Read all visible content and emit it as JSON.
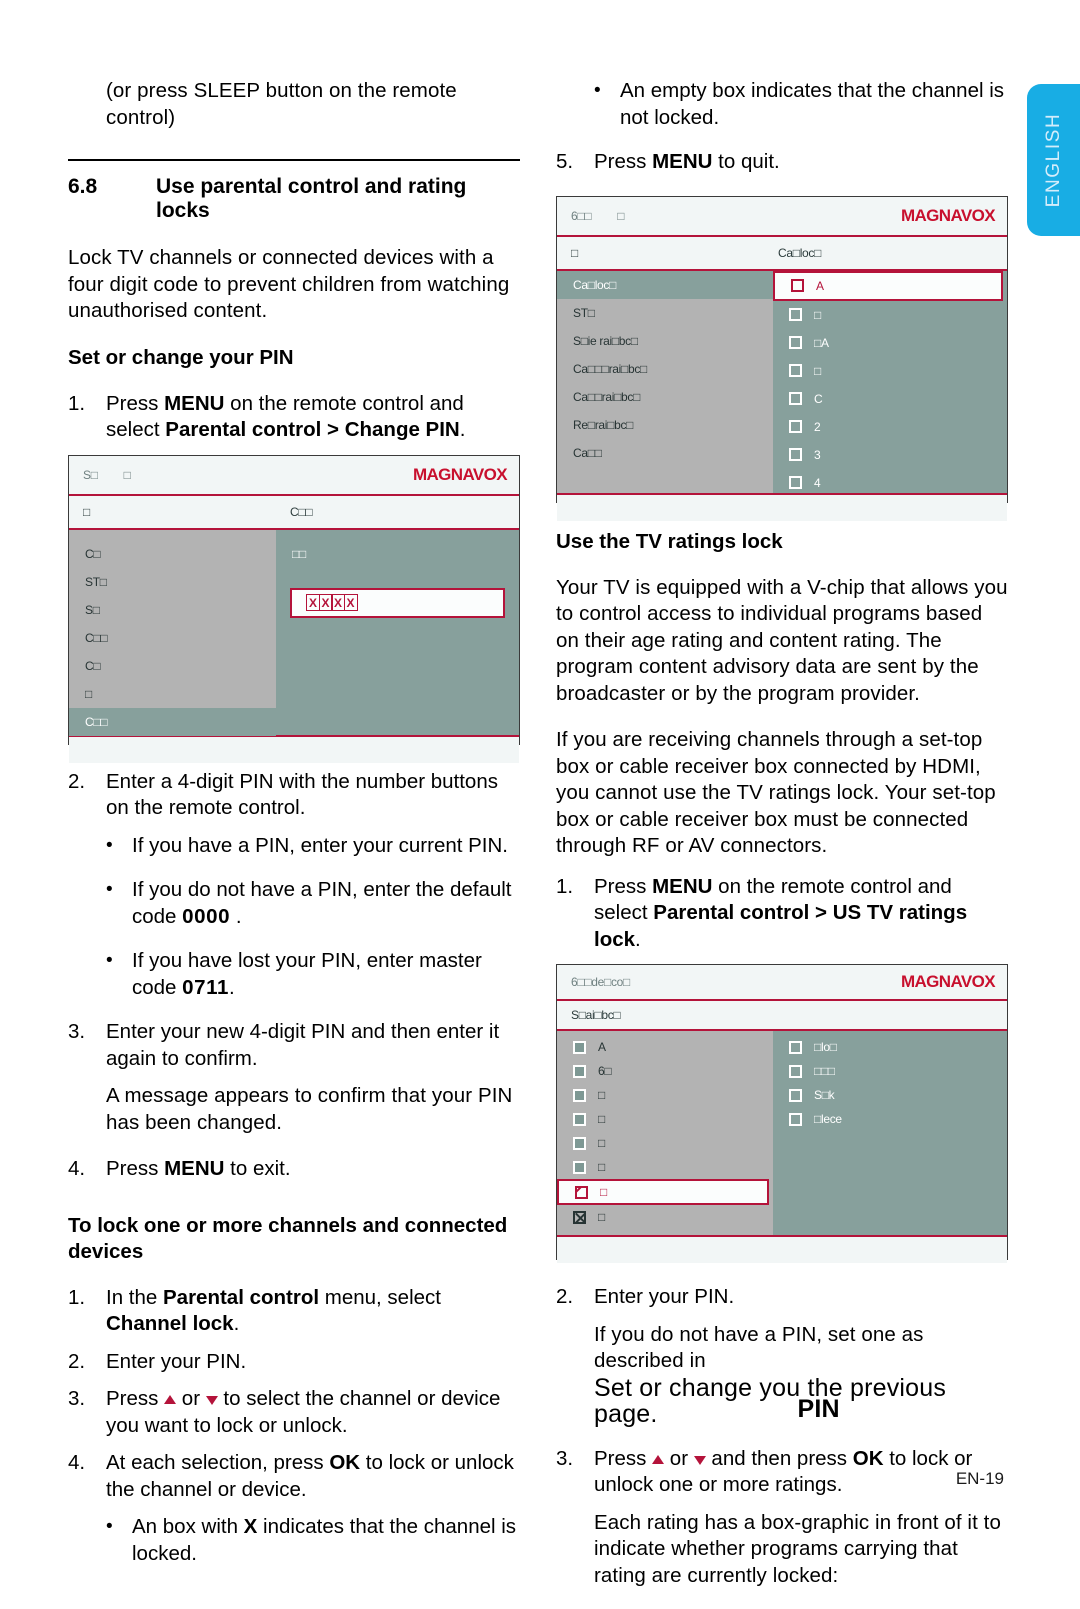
{
  "page": {
    "number_label": "EN-19",
    "language_tab": "ENGLISH",
    "accent_red": "#b4133a",
    "logo_red": "#c8102e",
    "tab_blue": "#18ade4",
    "pane_gray": "#b3b3b3",
    "pane_teal": "#87a09c"
  },
  "left_column": {
    "lead_line": "(or press SLEEP button on the remote control)",
    "section": {
      "number": "6.8",
      "title": "Use parental control and rating locks"
    },
    "intro": "Lock TV channels or connected devices with a four digit code to prevent children from watching unauthorised content.",
    "heading_pin": "Set or change your PIN",
    "step1": {
      "num": "1.",
      "text_a": "Press ",
      "bold_menu": "MENU",
      "text_b": " on the remote control and select",
      "bold_path": "Parental control > Change PIN",
      "text_c": "."
    },
    "step2": {
      "num": "2.",
      "text": "Enter a 4-digit PIN with the number buttons on the remote control."
    },
    "bullets_pin": [
      {
        "text": "If you have a PIN, enter your current PIN."
      },
      {
        "text_a": "If you do not have a PIN, enter the default code ",
        "code": "0000",
        "text_b": " ."
      },
      {
        "text_a": "If you have lost your PIN, enter master code ",
        "code": "0711",
        "text_b": "."
      }
    ],
    "step3": {
      "num": "3.",
      "text": "Enter your new 4-digit PIN and then enter it again to confirm.",
      "note": "A message appears to confirm that your PIN has been changed."
    },
    "step4": {
      "num": "4.",
      "text_a": "Press ",
      "bold_menu": "MENU",
      "text_b": " to exit."
    },
    "heading_lock": "To lock one or more channels and connected devices",
    "lock_step1": {
      "num": "1.",
      "text_a": "In the ",
      "bold_a": "Parental control",
      "text_b": " menu, select ",
      "bold_b": "Channel lock",
      "text_c": "."
    },
    "lock_step2": {
      "num": "2.",
      "text": "Enter your PIN."
    },
    "lock_step3": {
      "num": "3.",
      "text_a": "Press ",
      "text_b": " or ",
      "text_c": " to select the channel or device you want to lock or unlock."
    },
    "lock_step4": {
      "num": "4.",
      "text_a": "At each selection, press ",
      "bold_ok": "OK",
      "text_b": " to lock or unlock the channel or device."
    },
    "lock_bullet": {
      "text_a": "An box with ",
      "bold_x": "X",
      "text_b": " indicates that the channel is locked."
    }
  },
  "right_column": {
    "bullet_empty_box": "An empty box indicates that the channel is not locked.",
    "step5": {
      "num": "5.",
      "text_a": "Press ",
      "bold_menu": "MENU",
      "text_b": " to quit."
    },
    "heading_tv_ratings": "Use the TV ratings lock",
    "para_vchip": "Your TV is equipped with a V-chip that allows you to control access to individual programs based on their age rating and content rating. The program content advisory data are sent by the broadcaster or by the program provider.",
    "para_settop": "If you are receiving channels through a set-top box or cable receiver box connected by HDMI, you cannot use the TV ratings lock. Your set-top box or cable receiver box must be connected through RF or AV connectors.",
    "rate_step1": {
      "num": "1.",
      "text_a": "Press ",
      "bold_menu": "MENU",
      "text_b": " on the remote control and select",
      "bold_path": "Parental control > US TV ratings lock",
      "text_c": "."
    },
    "rate_step2": {
      "num": "2.",
      "text": "Enter your PIN.",
      "note_a": "If you do not have a PIN, set one as described in",
      "note_overlap_under": "Set or change you ",
      "note_overlap_over": "PIN",
      "note_overlap_tail": "the previous page."
    },
    "rate_step3": {
      "num": "3.",
      "text_a": "Press ",
      "text_b": " or ",
      "text_c": " and then press ",
      "bold_ok": "OK",
      "text_d": " to lock or unlock one or more ratings.",
      "note": "Each rating has a box-graphic in front of it to indicate whether programs carrying that rating are currently locked:"
    }
  },
  "screenshots": {
    "change_pin": {
      "brand": "MAGNAVOX",
      "crumb_1": "S□",
      "crumb_2": "□",
      "title_left": "□",
      "title_right": "C□□",
      "menu_items": [
        {
          "label": "C□",
          "selected": false
        },
        {
          "label": "ST□",
          "selected": false
        },
        {
          "label": "S□",
          "selected": false
        },
        {
          "label": "C□□",
          "selected": false
        },
        {
          "label": "C□",
          "selected": false
        },
        {
          "label": "□",
          "selected": false
        },
        {
          "label": "C□□",
          "selected": true
        }
      ],
      "right_label": "□□",
      "pin_digits": [
        "X",
        "X",
        "X",
        "X"
      ]
    },
    "channel_lock": {
      "brand": "MAGNAVOX",
      "crumb_1": "6□□",
      "crumb_2": "□",
      "title_left": "□",
      "title_right": "Ca□loc□",
      "menu_items": [
        {
          "label": "Ca□loc□",
          "selected": true
        },
        {
          "label": "ST□",
          "selected": false
        },
        {
          "label": "S□ie rai□bc□",
          "selected": false
        },
        {
          "label": "Ca□□□rai□bc□",
          "selected": false
        },
        {
          "label": "Ca□□rai□bc□",
          "selected": false
        },
        {
          "label": "Re□rai□bc□",
          "selected": false
        },
        {
          "label": "Ca□□",
          "selected": false
        }
      ],
      "channel_rows": [
        {
          "label": "A",
          "highlight": true
        },
        {
          "label": "□",
          "highlight": false
        },
        {
          "label": "□A",
          "highlight": false
        },
        {
          "label": "□",
          "highlight": false
        },
        {
          "label": "C",
          "highlight": false
        },
        {
          "label": "2",
          "highlight": false
        },
        {
          "label": "3",
          "highlight": false
        },
        {
          "label": "4",
          "highlight": false
        }
      ]
    },
    "us_tv_ratings": {
      "brand": "MAGNAVOX",
      "crumb_1": "6□□de□co□",
      "title_left": "S□ai□bc□",
      "ratings_left": [
        {
          "label": "A",
          "box": "filled"
        },
        {
          "label": "6□",
          "box": "filled"
        },
        {
          "label": "□",
          "box": "filled"
        },
        {
          "label": "□",
          "box": "filled"
        },
        {
          "label": "□",
          "box": "filled"
        },
        {
          "label": "□",
          "box": "filled"
        },
        {
          "label": "□",
          "box": "slash",
          "highlight": true
        },
        {
          "label": "□",
          "box": "xbox"
        }
      ],
      "content_right": [
        {
          "label": "□lo□",
          "box": "empty"
        },
        {
          "label": "□□□",
          "box": "empty"
        },
        {
          "label": "S□k",
          "box": "empty"
        },
        {
          "label": "□lece",
          "box": "empty"
        }
      ]
    }
  }
}
